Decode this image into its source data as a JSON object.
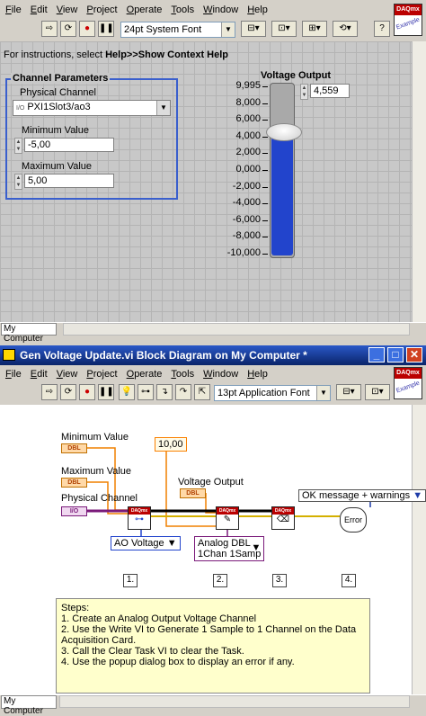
{
  "front": {
    "menu": [
      "File",
      "Edit",
      "View",
      "Project",
      "Operate",
      "Tools",
      "Window",
      "Help"
    ],
    "font_select": "24pt System Font",
    "instructions_prefix": "For instructions, select ",
    "instructions_bold": "Help>>Show Context Help",
    "group_title": "Channel Parameters",
    "physical_channel_label": "Physical Channel",
    "physical_channel_value": "PXI1Slot3/ao3",
    "min_label": "Minimum Value",
    "min_value": "-5,00",
    "max_label": "Maximum Value",
    "max_value": "5,00",
    "slider_title": "Voltage Output",
    "slider_value": "4,559",
    "slider_scale": [
      "9,995",
      "8,000",
      "6,000",
      "4,000",
      "2,000",
      "0,000",
      "-2,000",
      "-4,000",
      "-6,000",
      "-8,000",
      "-10,000"
    ],
    "slider_level": 0.728,
    "status": "My Computer",
    "badge": "DAQmx",
    "badge_sub": "Example"
  },
  "block": {
    "title": "Gen Voltage Update.vi Block Diagram on My Computer *",
    "menu": [
      "File",
      "Edit",
      "View",
      "Project",
      "Operate",
      "Tools",
      "Window",
      "Help"
    ],
    "font_select": "13pt Application Font",
    "min_label": "Minimum Value",
    "max_label": "Maximum Value",
    "channel_label": "Physical Channel",
    "voltage_label": "Voltage Output",
    "constant": "10,00",
    "dbl": "DBL",
    "io": "I/O",
    "ao_voltage": "AO Voltage",
    "analog_dbl_1": "Analog DBL",
    "analog_dbl_2": "1Chan 1Samp",
    "ok_message": "OK message + warnings",
    "error_label": "Error",
    "step_labels": [
      "1.",
      "2.",
      "3.",
      "4."
    ],
    "steps_title": "Steps:",
    "steps": [
      "1. Create an Analog Output Voltage Channel",
      "2. Use the Write VI to Generate 1 Sample to 1 Channel on the Data Acquisition Card.",
      "3.   Call the Clear Task VI to clear the Task.",
      "4.   Use the popup dialog box to display an error if any."
    ],
    "status": "My Computer",
    "daq_head": "DAQmx"
  },
  "colors": {
    "title_blue": "#0a246a",
    "slider_fill": "#2244cc",
    "wire_orange": "#f08000",
    "wire_purple": "#7a1a7a"
  }
}
